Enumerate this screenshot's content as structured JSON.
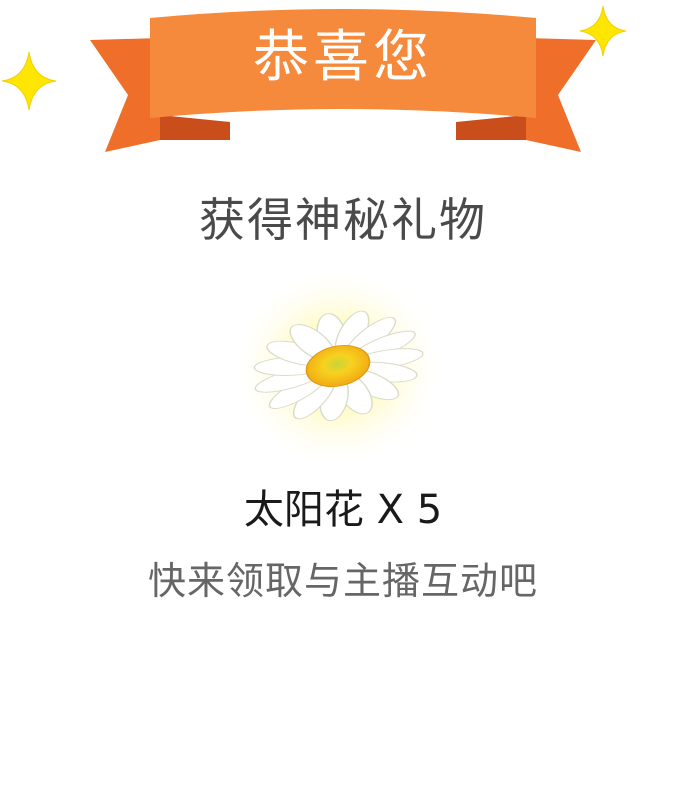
{
  "banner": {
    "title": "恭喜您"
  },
  "subtitle": "获得神秘礼物",
  "gift": {
    "name": "太阳花",
    "multiplier": "X",
    "quantity": "5",
    "icon": "sunflower-daisy-icon"
  },
  "hint": "快来领取与主播互动吧",
  "colors": {
    "ribbon_front": "#f58a3c",
    "ribbon_back": "#ef6f2a",
    "ribbon_fold": "#c94e1c",
    "sparkle": "#ffe600",
    "flower_center": "#f7c51d",
    "glow": "#fff7a0"
  }
}
